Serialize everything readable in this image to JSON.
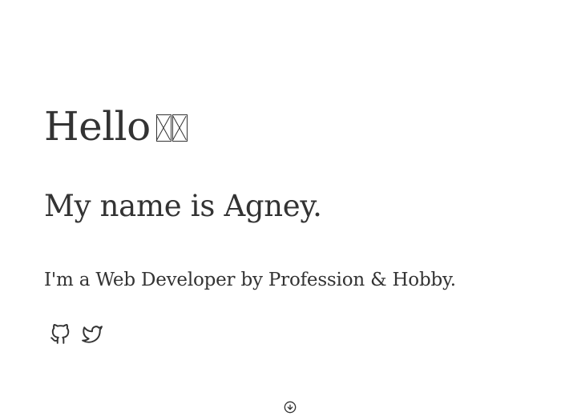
{
  "hero": {
    "greeting": "Hello",
    "wave_emoji": "👋🏼",
    "name_line": "My name is Agney.",
    "tagline": "I'm a Web Developer by Profession & Hobby."
  },
  "socials": [
    {
      "name": "github",
      "icon": "github-icon"
    },
    {
      "name": "twitter",
      "icon": "twitter-icon"
    }
  ],
  "scroll": {
    "icon": "arrow-down-circle-icon"
  },
  "colors": {
    "text": "#333333",
    "background": "#ffffff"
  }
}
